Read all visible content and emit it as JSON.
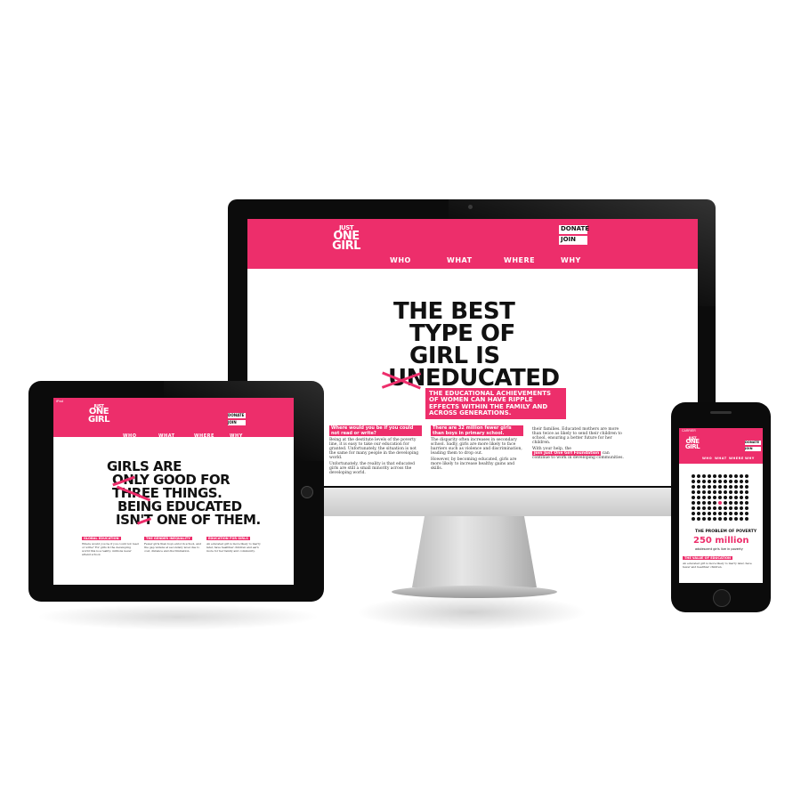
{
  "brand": {
    "logo_line1": "JUST",
    "logo_line2": "ONE",
    "logo_line3": "GIRL",
    "accent_color": "#ed2e6b"
  },
  "nav": [
    "WHO",
    "WHAT",
    "WHERE",
    "WHY"
  ],
  "actions": {
    "donate": "DONATE",
    "join": "JOIN"
  },
  "desktop": {
    "headline_line1": "THE BEST",
    "headline_line2": "TYPE OF",
    "headline_line3": "GIRL IS",
    "headline_line4": "UNEDUCATED",
    "subhead": "THE EDUCATIONAL ACHIEVEMENTS OF WOMEN CAN HAVE RIPPLE EFFECTS WITHIN THE FAMILY AND ACROSS GENERATIONS.",
    "col1_heading": "Where would you be if you could not read or write?",
    "col2_heading": "There are 32 million fewer girls than boys in primary school.",
    "col3_note": "Join Just One Girl Foundation"
  },
  "tablet": {
    "status_left": "iPad",
    "headline_line1": "GIRLS ARE",
    "headline_line2": "ONLY GOOD FOR",
    "headline_line3": "THREE THINGS.",
    "headline_line4": "BEING EDUCATED",
    "headline_line5": "ISN'T ONE OF THEM.",
    "col1_heading": "GLOBAL EDUCATION",
    "col2_heading": "THE GENDER INEQUALITY",
    "col3_heading": "EDUCATION FOR GIRLS"
  },
  "phone": {
    "status_left": "CARRIER",
    "dots_caption": "THE PROBLEM OF POVERTY",
    "big_number": "250 million",
    "small_caption": "adolescent girls live in poverty",
    "section_heading": "THE VALUE OF EDUCATION"
  }
}
